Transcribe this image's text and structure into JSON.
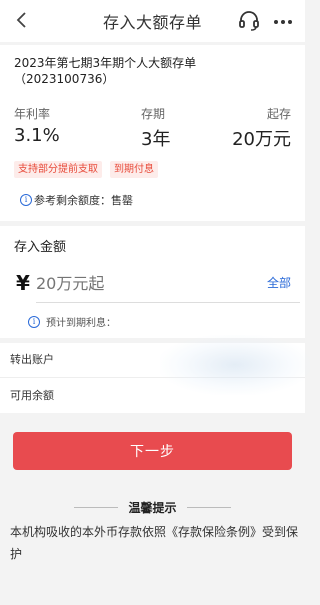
{
  "header": {
    "title": "存入大额存单",
    "back_icon": "chevron-left-icon",
    "support_icon": "headset-icon",
    "more_icon": "more-dots-icon"
  },
  "product": {
    "name": "2023年第七期3年期个人大额存单",
    "code": "（2023100736）",
    "rate_label": "年利率",
    "rate_value": "3.1%",
    "term_label": "存期",
    "term_value": "3年",
    "min_label": "起存",
    "min_value": "20万元",
    "tags": [
      "支持部分提前支取",
      "到期付息"
    ],
    "remaining_label": "参考剩余额度：",
    "remaining_value": "售罄"
  },
  "deposit": {
    "label": "存入金额",
    "currency_symbol": "¥",
    "amount_placeholder": "20万元起",
    "all_label": "全部",
    "expected_interest_label": "预计到期利息："
  },
  "accounts": {
    "from_account_label": "转出账户",
    "available_balance_label": "可用余额"
  },
  "next_button": "下一步",
  "tips": {
    "title": "温馨提示",
    "body": "本机构吸收的本外币存款依照《存款保险条例》受到保护"
  },
  "colors": {
    "accent_red": "#e84b4f",
    "link_blue": "#2a6ad8",
    "tag_red": "#e84b3b",
    "background": "#f3f3f3"
  }
}
